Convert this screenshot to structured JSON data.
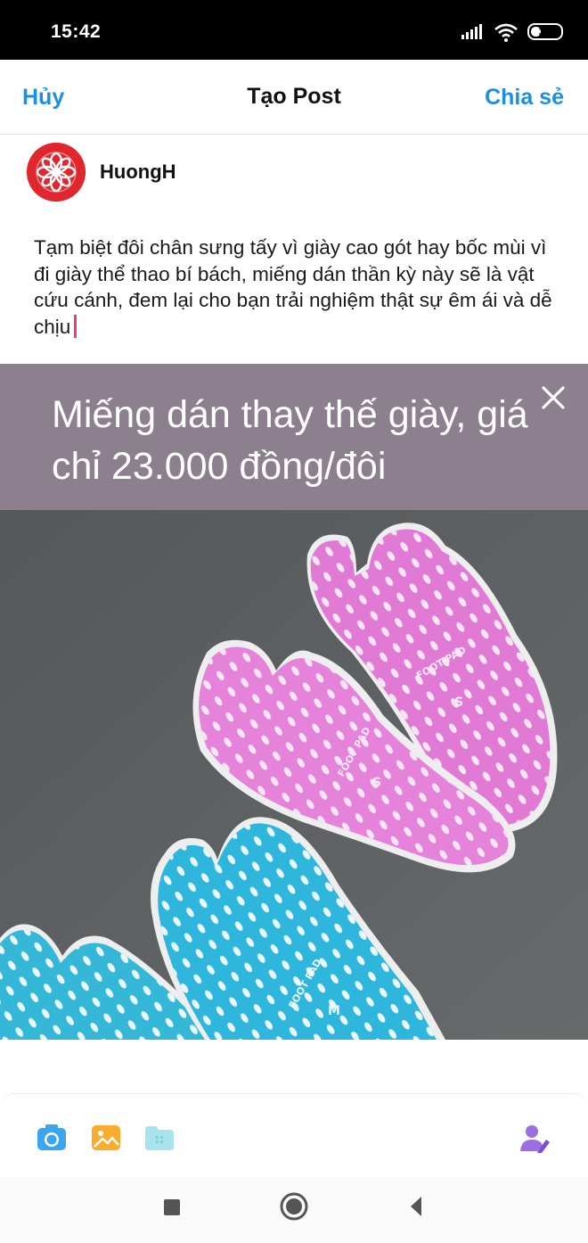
{
  "status": {
    "time": "15:42",
    "battery": "33",
    "battery_level": 0.33
  },
  "header": {
    "cancel_label": "Hủy",
    "title": "Tạo Post",
    "share_label": "Chia sẻ"
  },
  "user": {
    "name": "HuongH"
  },
  "post": {
    "text": "Tạm biệt đôi chân sưng tấy vì giày cao gót hay bốc mùi vì đi giày thể thao bí bách, miếng dán thần kỳ này sẽ là vật cứu cánh, đem lại cho bạn trải nghiệm thật sự êm ái và dễ chịu"
  },
  "banner": {
    "headline": "Miếng dán thay thế giày, giá chỉ 23.000 đồng/đôi"
  },
  "photo": {
    "pads": [
      {
        "brand": "FOOT PAD",
        "size": "S"
      },
      {
        "brand": "FOOT PAD",
        "size": "S"
      },
      {
        "brand": "FOOT PAD",
        "size": "M"
      }
    ]
  },
  "toolbar": {
    "icons": [
      "camera-icon",
      "image-gallery-icon",
      "folder-icon",
      "tag-user-icon"
    ]
  },
  "colors": {
    "accent": "#1b8fe6",
    "banner": "#8c7f8e",
    "pink_pad": "#e07ad4",
    "blue_pad": "#35b8d8",
    "caret": "#e8407a"
  }
}
